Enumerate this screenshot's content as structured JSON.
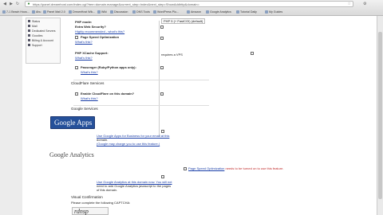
{
  "browser": {
    "url": "https://panel.dreamhost.com/index.cgi?tree=domain.manage&current_step=Index&next_step=ShowAddhttp&domain=",
    "bookmarks": [
      "7-1 Beach Hous...",
      "Ahu",
      "Panel Mail 2.0",
      "DreamHost Wik...",
      "Wiki",
      "Discussion",
      "DNS Tools",
      "WordPress Plu...",
      "Amazon",
      "Google Analytics",
      "Tutorial Daily",
      "My Guides"
    ]
  },
  "leftnav": {
    "items": [
      "Status",
      "Mail",
      "Dedicated Servers",
      "Goodies",
      "Billing & Account",
      "Support"
    ]
  },
  "form": {
    "php_mode_label": "PHP mode:",
    "php_mode_value": "PHP 5 (+ FastCGI) (default)",
    "extra_security_label": "Extra Web Security?",
    "extra_security_note": "Highly recommended - what's this?",
    "page_speed_label": "Page Speed Optimization",
    "page_speed_what": "What's this?",
    "passenger_what": "What's this?",
    "php_xcache_label": "PHP XCache Support:",
    "php_xcache_value": "requires a VPS",
    "passenger_label": "Passenger (Ruby/Python apps only):",
    "passenger_what2": "What's this?",
    "cloudflare_heading": "CloudFlare Services",
    "cloudflare_label": "Enable CloudFlare on this domain?",
    "cloudflare_what": "What's this?",
    "google_heading": "Google Services",
    "google_apps_logo": "Google Apps",
    "google_apps_line1": "Use Google Apps for Business for your email at this",
    "google_apps_line2": "domain.",
    "google_apps_line3": "(Google may charge you to use this feature.)",
    "page_speed_warning_label": "Page Speed Optimization",
    "page_speed_warning_text": "needs to be turned on to use this feature.",
    "google_analytics_logo": "Google Analytics",
    "ga_line1": "Use Google Analytics at this domain now. You will not",
    "ga_line2": "need to add Google Analytics javascript to the pages",
    "ga_line3": "of this domain.",
    "visual_heading": "Visual Confirmation",
    "visual_text": "Please complete the following CAPTCHA:",
    "captcha_text": "rdnsp"
  }
}
